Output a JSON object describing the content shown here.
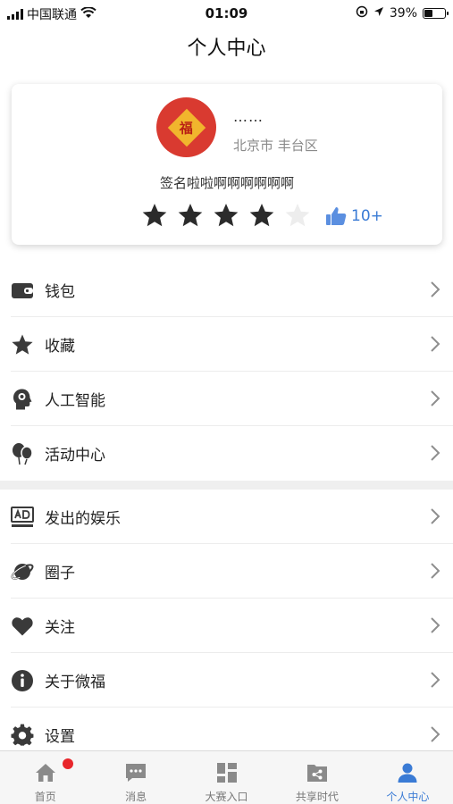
{
  "status_bar": {
    "carrier": "中国联通",
    "time": "01:09",
    "battery": "39%",
    "battery_level": 0.39
  },
  "page": {
    "title": "个人中心"
  },
  "profile": {
    "avatar_text": "福",
    "username": "……",
    "location": "北京市 丰台区",
    "signature": "签名啦啦啊啊啊啊啊啊",
    "rating_filled": 4,
    "rating_max": 5,
    "likes": "10+"
  },
  "menu": {
    "group1": [
      {
        "label": "钱包",
        "icon": "wallet-icon"
      },
      {
        "label": "收藏",
        "icon": "star-icon"
      },
      {
        "label": "人工智能",
        "icon": "ai-head-icon"
      },
      {
        "label": "活动中心",
        "icon": "balloons-icon"
      }
    ],
    "group2": [
      {
        "label": "发出的娱乐",
        "icon": "ad-icon"
      },
      {
        "label": "圈子",
        "icon": "planet-icon"
      },
      {
        "label": "关注",
        "icon": "heart-icon"
      },
      {
        "label": "关于微福",
        "icon": "info-icon"
      },
      {
        "label": "设置",
        "icon": "gear-icon"
      }
    ]
  },
  "tabs": [
    {
      "label": "首页",
      "icon": "home-icon",
      "badge": true
    },
    {
      "label": "消息",
      "icon": "message-icon"
    },
    {
      "label": "大赛入口",
      "icon": "dashboard-icon"
    },
    {
      "label": "共享时代",
      "icon": "share-icon"
    },
    {
      "label": "个人中心",
      "icon": "user-icon",
      "active": true
    }
  ],
  "colors": {
    "accent": "#3a7bd5",
    "icon_dark": "#3a3a3a",
    "tab_gray": "#888888",
    "badge_red": "#e8262b",
    "avatar_red": "#d93a30"
  }
}
